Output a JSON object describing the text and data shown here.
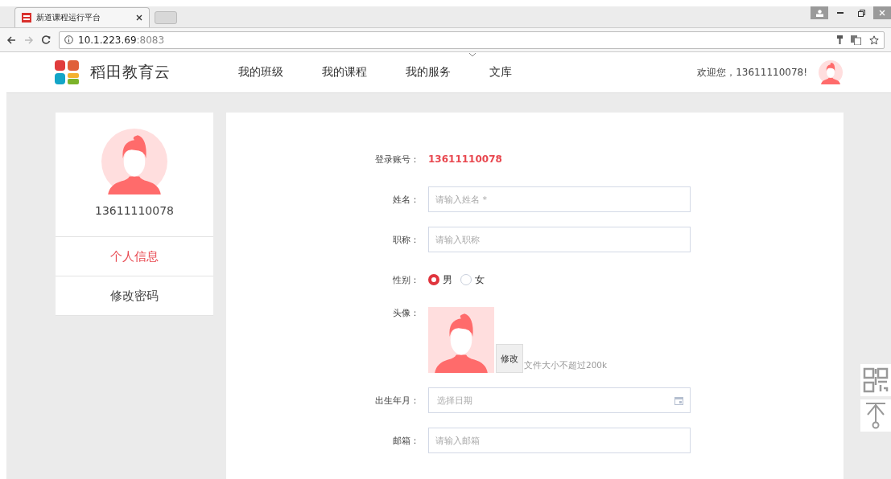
{
  "browser": {
    "tab_title": "新道课程运行平台",
    "url_host": "10.1.223.69",
    "url_port": ":8083"
  },
  "header": {
    "logo_text": "稻田教育云",
    "nav": [
      "我的班级",
      "我的课程",
      "我的服务",
      "文库"
    ],
    "welcome": "欢迎您，13611110078!"
  },
  "sidebar": {
    "username": "13611110078",
    "items": [
      {
        "label": "个人信息",
        "selected": true
      },
      {
        "label": "修改密码",
        "selected": false
      }
    ]
  },
  "form": {
    "rows": [
      {
        "kind": "static",
        "label": "登录账号：",
        "value": "13611110078"
      },
      {
        "kind": "text",
        "label": "姓名：",
        "placeholder": "请输入姓名 *"
      },
      {
        "kind": "text",
        "label": "职称：",
        "placeholder": "请输入职称"
      },
      {
        "kind": "radio",
        "label": "性别：",
        "options": [
          {
            "label": "男",
            "selected": true
          },
          {
            "label": "女",
            "selected": false
          }
        ]
      },
      {
        "kind": "avatar",
        "label": "头像：",
        "button": "修改",
        "hint": "文件大小不超过200k"
      },
      {
        "kind": "date",
        "label": "出生年月：",
        "placeholder": "选择日期"
      },
      {
        "kind": "text",
        "label": "邮箱：",
        "placeholder": "请输入邮箱"
      }
    ]
  }
}
